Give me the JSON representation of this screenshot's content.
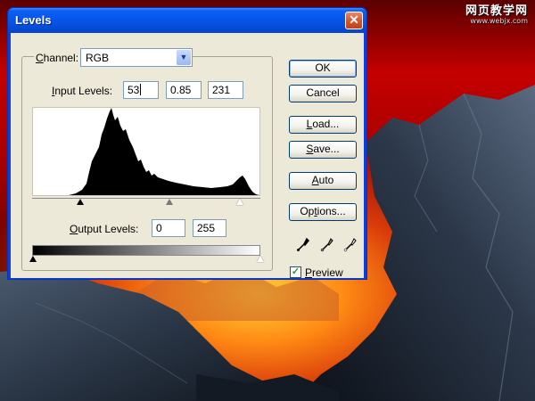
{
  "window": {
    "title": "Levels",
    "close_symbol": "✕"
  },
  "channel": {
    "label_pre": "",
    "label_key": "C",
    "label_post": "hannel:",
    "value": "RGB"
  },
  "input_levels": {
    "label_key": "I",
    "label_post": "nput Levels:",
    "black": "53",
    "gamma": "0.85",
    "white": "231"
  },
  "output_levels": {
    "label_key": "O",
    "label_post": "utput Levels:",
    "black": "0",
    "white": "255"
  },
  "buttons": {
    "ok": "OK",
    "cancel": "Cancel",
    "load": {
      "key": "L",
      "rest": "oad..."
    },
    "save": {
      "key": "S",
      "rest": "ave..."
    },
    "auto": {
      "key": "A",
      "rest": "uto"
    },
    "options": {
      "key": "",
      "pre": "Op",
      "key2": "t",
      "rest": "ions..."
    }
  },
  "preview": {
    "key": "P",
    "rest": "review",
    "checked": true
  },
  "watermark": {
    "line1": "网页教学网",
    "line2": "www.webjx.com"
  },
  "icons": [
    "close-icon",
    "chevron-down-icon",
    "black-eyedropper-icon",
    "gray-eyedropper-icon",
    "white-eyedropper-icon",
    "checkmark-icon"
  ]
}
